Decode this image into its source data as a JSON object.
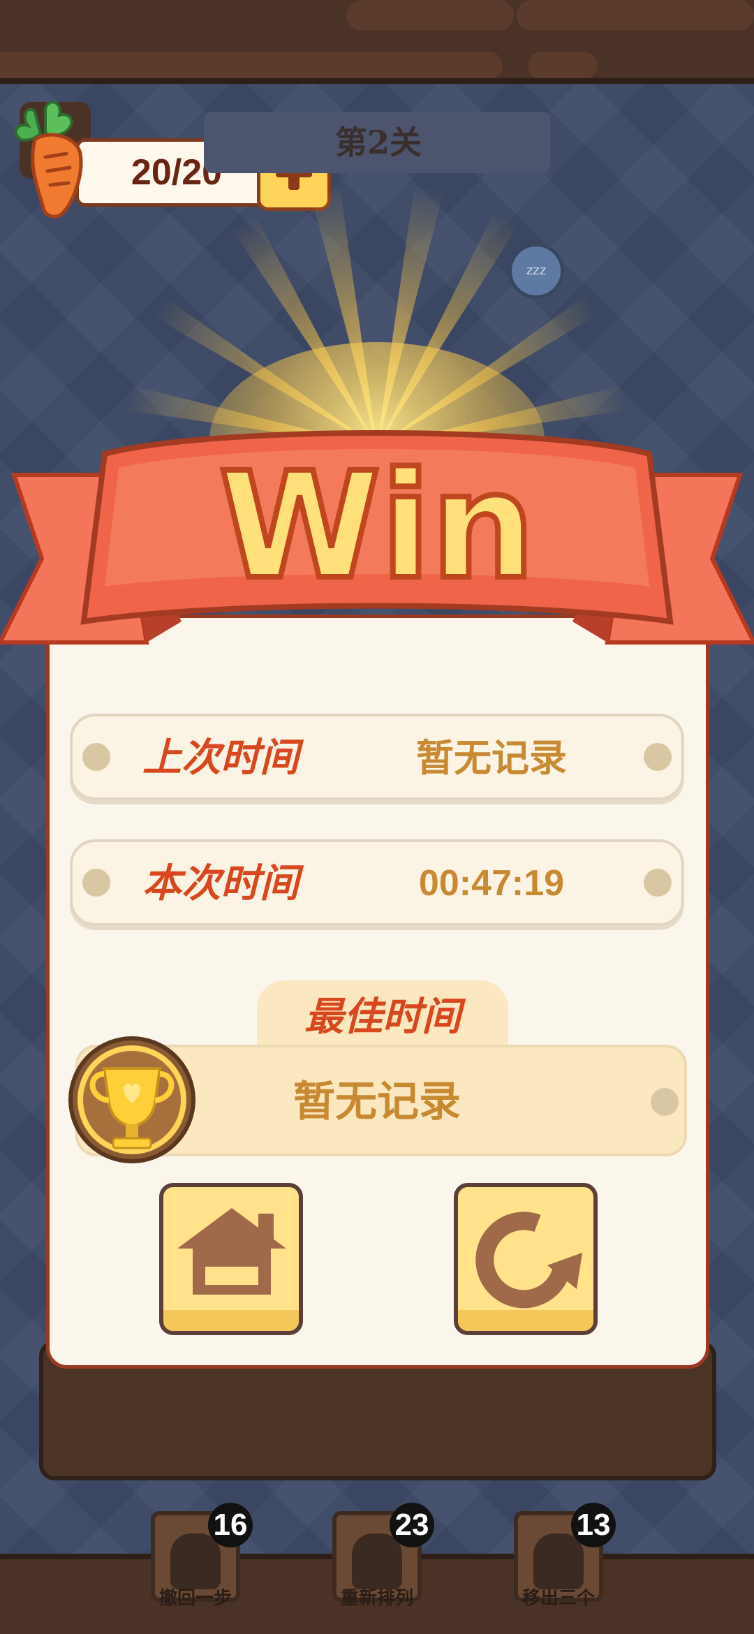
{
  "hud": {
    "stamina": "20/20",
    "level_title": "第2关",
    "sleep_indicator": "zzz"
  },
  "result": {
    "banner_text": "Win",
    "last_time_label": "上次时间",
    "last_time_value": "暂无记录",
    "this_time_label": "本次时间",
    "this_time_value": "00:47:19",
    "best_time_label": "最佳时间",
    "best_time_value": "暂无记录"
  },
  "actions": {
    "home_icon": "home-icon",
    "replay_icon": "replay-icon"
  },
  "powerups": [
    {
      "label": "撤回一步",
      "count": "16"
    },
    {
      "label": "重新排列",
      "count": "23"
    },
    {
      "label": "移出三个",
      "count": "13"
    }
  ],
  "colors": {
    "banner_red": "#f0654a",
    "win_yellow": "#ffe07a",
    "label_red": "#d8471d",
    "value_gold": "#c78a33"
  }
}
